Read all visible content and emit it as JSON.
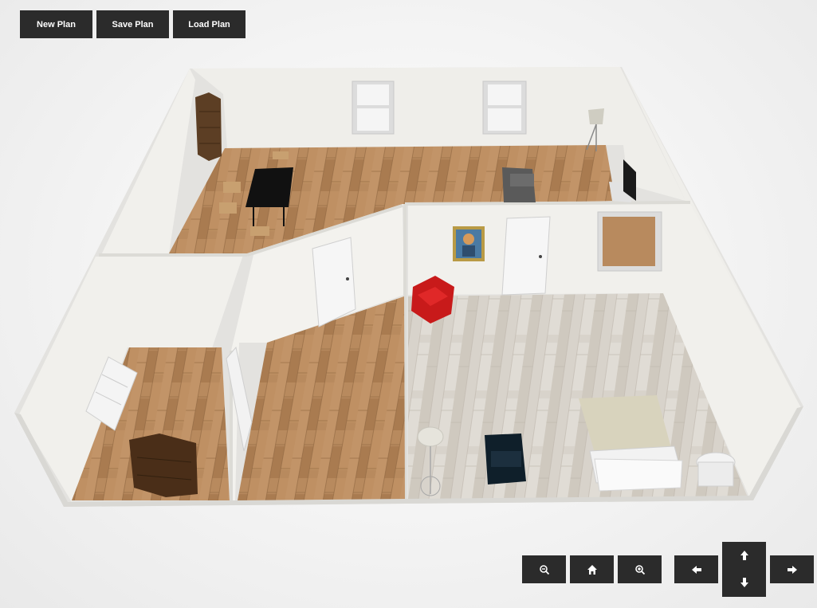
{
  "toolbar": {
    "new_label": "New Plan",
    "save_label": "Save Plan",
    "load_label": "Load Plan"
  },
  "controls": {
    "zoom_out": "zoom-out-icon",
    "home": "home-icon",
    "zoom_in": "zoom-in-icon",
    "pan_left": "arrow-left-icon",
    "pan_up": "arrow-up-icon",
    "pan_down": "arrow-down-icon",
    "pan_right": "arrow-right-icon"
  },
  "colors": {
    "button_bg": "#2b2b2b",
    "button_text": "#ffffff",
    "wall": "#ecebe7",
    "wood_floor": "#b88a5e",
    "light_floor": "#d9d4cc"
  }
}
